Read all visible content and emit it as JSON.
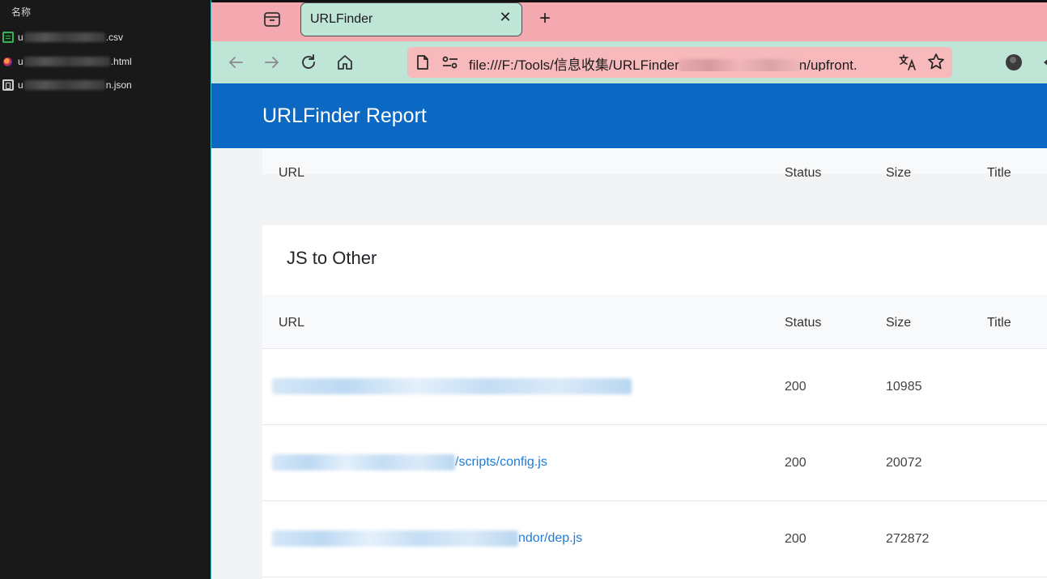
{
  "explorer": {
    "column_header": "名称",
    "files": [
      {
        "icon": "csv-file-icon",
        "prefix": "u",
        "suffix": ".csv"
      },
      {
        "icon": "firefox-html-icon",
        "prefix": "u",
        "suffix": ".html"
      },
      {
        "icon": "json-file-icon",
        "prefix": "u",
        "suffix": "n.json"
      }
    ]
  },
  "browser": {
    "tab_title": "URLFinder",
    "tab_close": "✕",
    "new_tab": "+",
    "address": {
      "url_start": "file:///F:/Tools/信息收集/URLFinder",
      "url_end": "n/upfront."
    }
  },
  "report": {
    "brand": "URLFinder Report",
    "prev_table_headers": {
      "url": "URL",
      "status": "Status",
      "size": "Size",
      "title": "Title"
    },
    "section_title": "JS to Other",
    "table_headers": {
      "url": "URL",
      "status": "Status",
      "size": "Size",
      "title": "Title"
    },
    "rows": [
      {
        "url_visible": "",
        "status": "200",
        "size": "10985",
        "title": ""
      },
      {
        "url_visible": "/scripts/config.js",
        "status": "200",
        "size": "20072",
        "title": ""
      },
      {
        "url_visible": "ndor/dep.js",
        "status": "200",
        "size": "272872",
        "title": ""
      }
    ]
  },
  "colors": {
    "tabstrip": "#f4a9b0",
    "toolbar": "#bfe5d6",
    "addressbar": "#f7b9bb",
    "navbar": "#0b69c4",
    "link": "#1e7bd6"
  }
}
